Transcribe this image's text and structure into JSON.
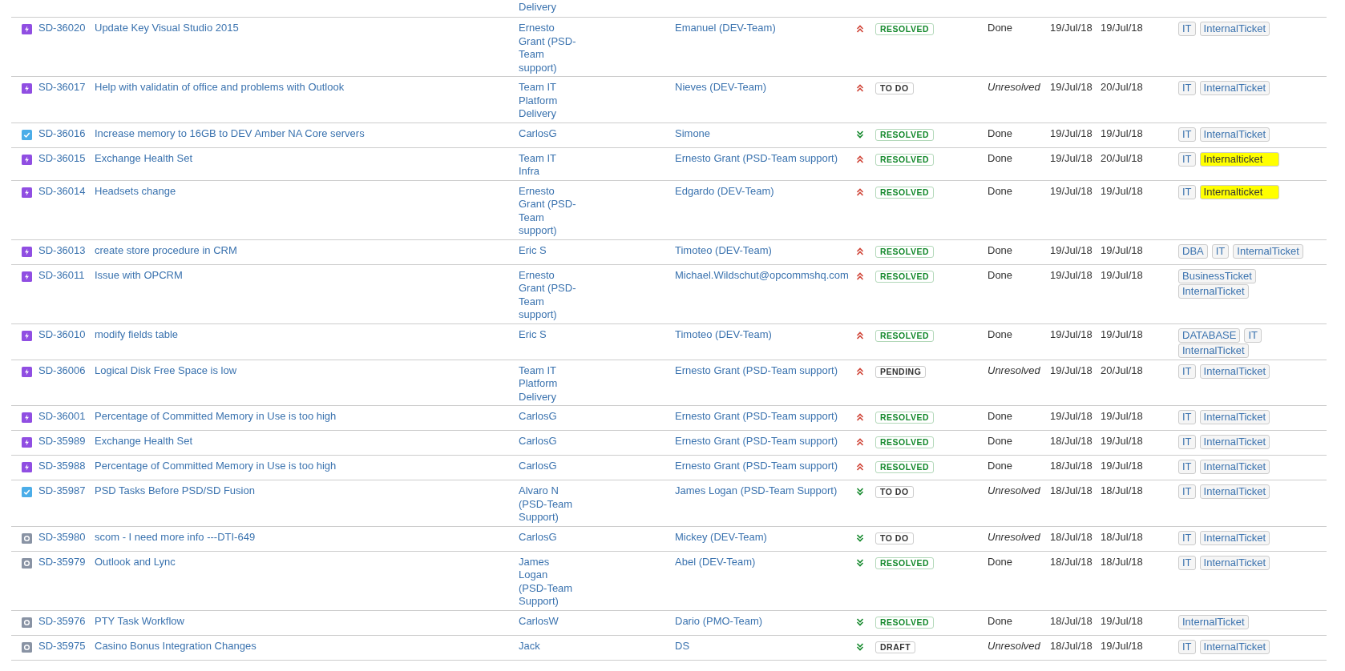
{
  "top_partial_row": {
    "reporter": "Delivery"
  },
  "issues": [
    {
      "kind": "service_request",
      "key": "SD-36020",
      "summary": "Update Key Visual Studio 2015",
      "reporter": "Ernesto Grant (PSD-Team support)",
      "assignee": "Emanuel (DEV-Team)",
      "high_priority": true,
      "status": "RESOLVED",
      "status_done": true,
      "resolution": "Done",
      "unresolved": false,
      "created": "19/Jul/18",
      "updated": "19/Jul/18",
      "labels": [
        {
          "text": "IT",
          "highlighted": false
        },
        {
          "text": "InternalTicket",
          "highlighted": false
        }
      ]
    },
    {
      "kind": "service_request",
      "key": "SD-36017",
      "summary": "Help with validatin of office and problems with Outlook",
      "reporter": "Team IT Platform Delivery",
      "assignee": "Nieves (DEV-Team)",
      "high_priority": true,
      "status": "TO DO",
      "status_done": false,
      "resolution": "Unresolved",
      "unresolved": true,
      "created": "19/Jul/18",
      "updated": "20/Jul/18",
      "labels": [
        {
          "text": "IT",
          "highlighted": false
        },
        {
          "text": "InternalTicket",
          "highlighted": false
        }
      ]
    },
    {
      "kind": "task",
      "key": "SD-36016",
      "summary": "Increase memory to 16GB to DEV Amber NA Core servers",
      "reporter": "CarlosG",
      "assignee": "Simone",
      "high_priority": false,
      "status": "RESOLVED",
      "status_done": true,
      "resolution": "Done",
      "unresolved": false,
      "created": "19/Jul/18",
      "updated": "19/Jul/18",
      "labels": [
        {
          "text": "IT",
          "highlighted": false
        },
        {
          "text": "InternalTicket",
          "highlighted": false
        }
      ]
    },
    {
      "kind": "service_request",
      "key": "SD-36015",
      "summary": "Exchange Health Set",
      "reporter": "Team IT Infra",
      "assignee": "Ernesto Grant (PSD-Team support)",
      "high_priority": true,
      "status": "RESOLVED",
      "status_done": true,
      "resolution": "Done",
      "unresolved": false,
      "created": "19/Jul/18",
      "updated": "20/Jul/18",
      "labels": [
        {
          "text": "IT",
          "highlighted": false
        },
        {
          "text": "Internalticket",
          "highlighted": true
        }
      ]
    },
    {
      "kind": "service_request",
      "key": "SD-36014",
      "summary": "Headsets change",
      "reporter": "Ernesto Grant (PSD-Team support)",
      "assignee": "Edgardo (DEV-Team)",
      "high_priority": true,
      "status": "RESOLVED",
      "status_done": true,
      "resolution": "Done",
      "unresolved": false,
      "created": "19/Jul/18",
      "updated": "19/Jul/18",
      "labels": [
        {
          "text": "IT",
          "highlighted": false
        },
        {
          "text": "Internalticket",
          "highlighted": true
        }
      ]
    },
    {
      "kind": "service_request",
      "key": "SD-36013",
      "summary": "create store procedure in CRM",
      "reporter": "Eric S",
      "assignee": "Timoteo (DEV-Team)",
      "high_priority": true,
      "status": "RESOLVED",
      "status_done": true,
      "resolution": "Done",
      "unresolved": false,
      "created": "19/Jul/18",
      "updated": "19/Jul/18",
      "labels": [
        {
          "text": "DBA",
          "highlighted": false
        },
        {
          "text": "IT",
          "highlighted": false
        },
        {
          "text": "InternalTicket",
          "highlighted": false
        }
      ]
    },
    {
      "kind": "service_request",
      "key": "SD-36011",
      "summary": "Issue with OPCRM",
      "reporter": "Ernesto Grant (PSD-Team support)",
      "assignee": "Michael.Wildschut@opcommshq.com",
      "high_priority": true,
      "status": "RESOLVED",
      "status_done": true,
      "resolution": "Done",
      "unresolved": false,
      "created": "19/Jul/18",
      "updated": "19/Jul/18",
      "labels": [
        {
          "text": "BusinessTicket",
          "highlighted": false
        },
        {
          "text": "InternalTicket",
          "highlighted": false
        }
      ]
    },
    {
      "kind": "service_request",
      "key": "SD-36010",
      "summary": "modify fields table",
      "reporter": "Eric S",
      "assignee": "Timoteo (DEV-Team)",
      "high_priority": true,
      "status": "RESOLVED",
      "status_done": true,
      "resolution": "Done",
      "unresolved": false,
      "created": "19/Jul/18",
      "updated": "19/Jul/18",
      "labels": [
        {
          "text": "DATABASE",
          "highlighted": false
        },
        {
          "text": "IT",
          "highlighted": false
        },
        {
          "text": "InternalTicket",
          "highlighted": false
        }
      ]
    },
    {
      "kind": "service_request",
      "key": "SD-36006",
      "summary": "Logical Disk Free Space is low",
      "reporter": "Team IT Platform Delivery",
      "assignee": "Ernesto Grant (PSD-Team support)",
      "high_priority": true,
      "status": "PENDING",
      "status_done": false,
      "resolution": "Unresolved",
      "unresolved": true,
      "created": "19/Jul/18",
      "updated": "20/Jul/18",
      "labels": [
        {
          "text": "IT",
          "highlighted": false
        },
        {
          "text": "InternalTicket",
          "highlighted": false
        }
      ]
    },
    {
      "kind": "service_request",
      "key": "SD-36001",
      "summary": "Percentage of Committed Memory in Use is too high",
      "reporter": "CarlosG",
      "assignee": "Ernesto Grant (PSD-Team support)",
      "high_priority": true,
      "status": "RESOLVED",
      "status_done": true,
      "resolution": "Done",
      "unresolved": false,
      "created": "19/Jul/18",
      "updated": "19/Jul/18",
      "labels": [
        {
          "text": "IT",
          "highlighted": false
        },
        {
          "text": "InternalTicket",
          "highlighted": false
        }
      ]
    },
    {
      "kind": "service_request",
      "key": "SD-35989",
      "summary": "Exchange Health Set",
      "reporter": "CarlosG",
      "assignee": "Ernesto Grant (PSD-Team support)",
      "high_priority": true,
      "status": "RESOLVED",
      "status_done": true,
      "resolution": "Done",
      "unresolved": false,
      "created": "18/Jul/18",
      "updated": "19/Jul/18",
      "labels": [
        {
          "text": "IT",
          "highlighted": false
        },
        {
          "text": "InternalTicket",
          "highlighted": false
        }
      ]
    },
    {
      "kind": "service_request",
      "key": "SD-35988",
      "summary": "Percentage of Committed Memory in Use is too high",
      "reporter": "CarlosG",
      "assignee": "Ernesto Grant (PSD-Team support)",
      "high_priority": true,
      "status": "RESOLVED",
      "status_done": true,
      "resolution": "Done",
      "unresolved": false,
      "created": "18/Jul/18",
      "updated": "19/Jul/18",
      "labels": [
        {
          "text": "IT",
          "highlighted": false
        },
        {
          "text": "InternalTicket",
          "highlighted": false
        }
      ]
    },
    {
      "kind": "task",
      "key": "SD-35987",
      "summary": "PSD Tasks Before PSD/SD Fusion",
      "reporter": "Alvaro N (PSD-Team Support)",
      "assignee": "James Logan (PSD-Team Support)",
      "high_priority": false,
      "status": "TO DO",
      "status_done": false,
      "resolution": "Unresolved",
      "unresolved": true,
      "created": "18/Jul/18",
      "updated": "18/Jul/18",
      "labels": [
        {
          "text": "IT",
          "highlighted": false
        },
        {
          "text": "InternalTicket",
          "highlighted": false
        }
      ]
    },
    {
      "kind": "other",
      "key": "SD-35980",
      "summary": "scom - I need more info ---DTI-649",
      "reporter": "CarlosG",
      "assignee": "Mickey (DEV-Team)",
      "high_priority": false,
      "status": "TO DO",
      "status_done": false,
      "resolution": "Unresolved",
      "unresolved": true,
      "created": "18/Jul/18",
      "updated": "18/Jul/18",
      "labels": [
        {
          "text": "IT",
          "highlighted": false
        },
        {
          "text": "InternalTicket",
          "highlighted": false
        }
      ]
    },
    {
      "kind": "other",
      "key": "SD-35979",
      "summary": "Outlook and Lync",
      "reporter": "James Logan (PSD-Team Support)",
      "assignee": "Abel (DEV-Team)",
      "high_priority": false,
      "status": "RESOLVED",
      "status_done": true,
      "resolution": "Done",
      "unresolved": false,
      "created": "18/Jul/18",
      "updated": "18/Jul/18",
      "labels": [
        {
          "text": "IT",
          "highlighted": false
        },
        {
          "text": "InternalTicket",
          "highlighted": false
        }
      ]
    },
    {
      "kind": "other",
      "key": "SD-35976",
      "summary": "PTY Task Workflow",
      "reporter": "CarlosW",
      "assignee": "Dario (PMO-Team)",
      "high_priority": false,
      "status": "RESOLVED",
      "status_done": true,
      "resolution": "Done",
      "unresolved": false,
      "created": "18/Jul/18",
      "updated": "19/Jul/18",
      "labels": [
        {
          "text": "InternalTicket",
          "highlighted": false
        }
      ]
    },
    {
      "kind": "other",
      "key": "SD-35975",
      "summary": "Casino Bonus Integration Changes",
      "reporter": "Jack",
      "assignee": "DS",
      "high_priority": false,
      "status": "DRAFT",
      "status_done": false,
      "resolution": "Unresolved",
      "unresolved": true,
      "created": "18/Jul/18",
      "updated": "19/Jul/18",
      "labels": [
        {
          "text": "IT",
          "highlighted": false
        },
        {
          "text": "InternalTicket",
          "highlighted": false
        }
      ]
    }
  ]
}
